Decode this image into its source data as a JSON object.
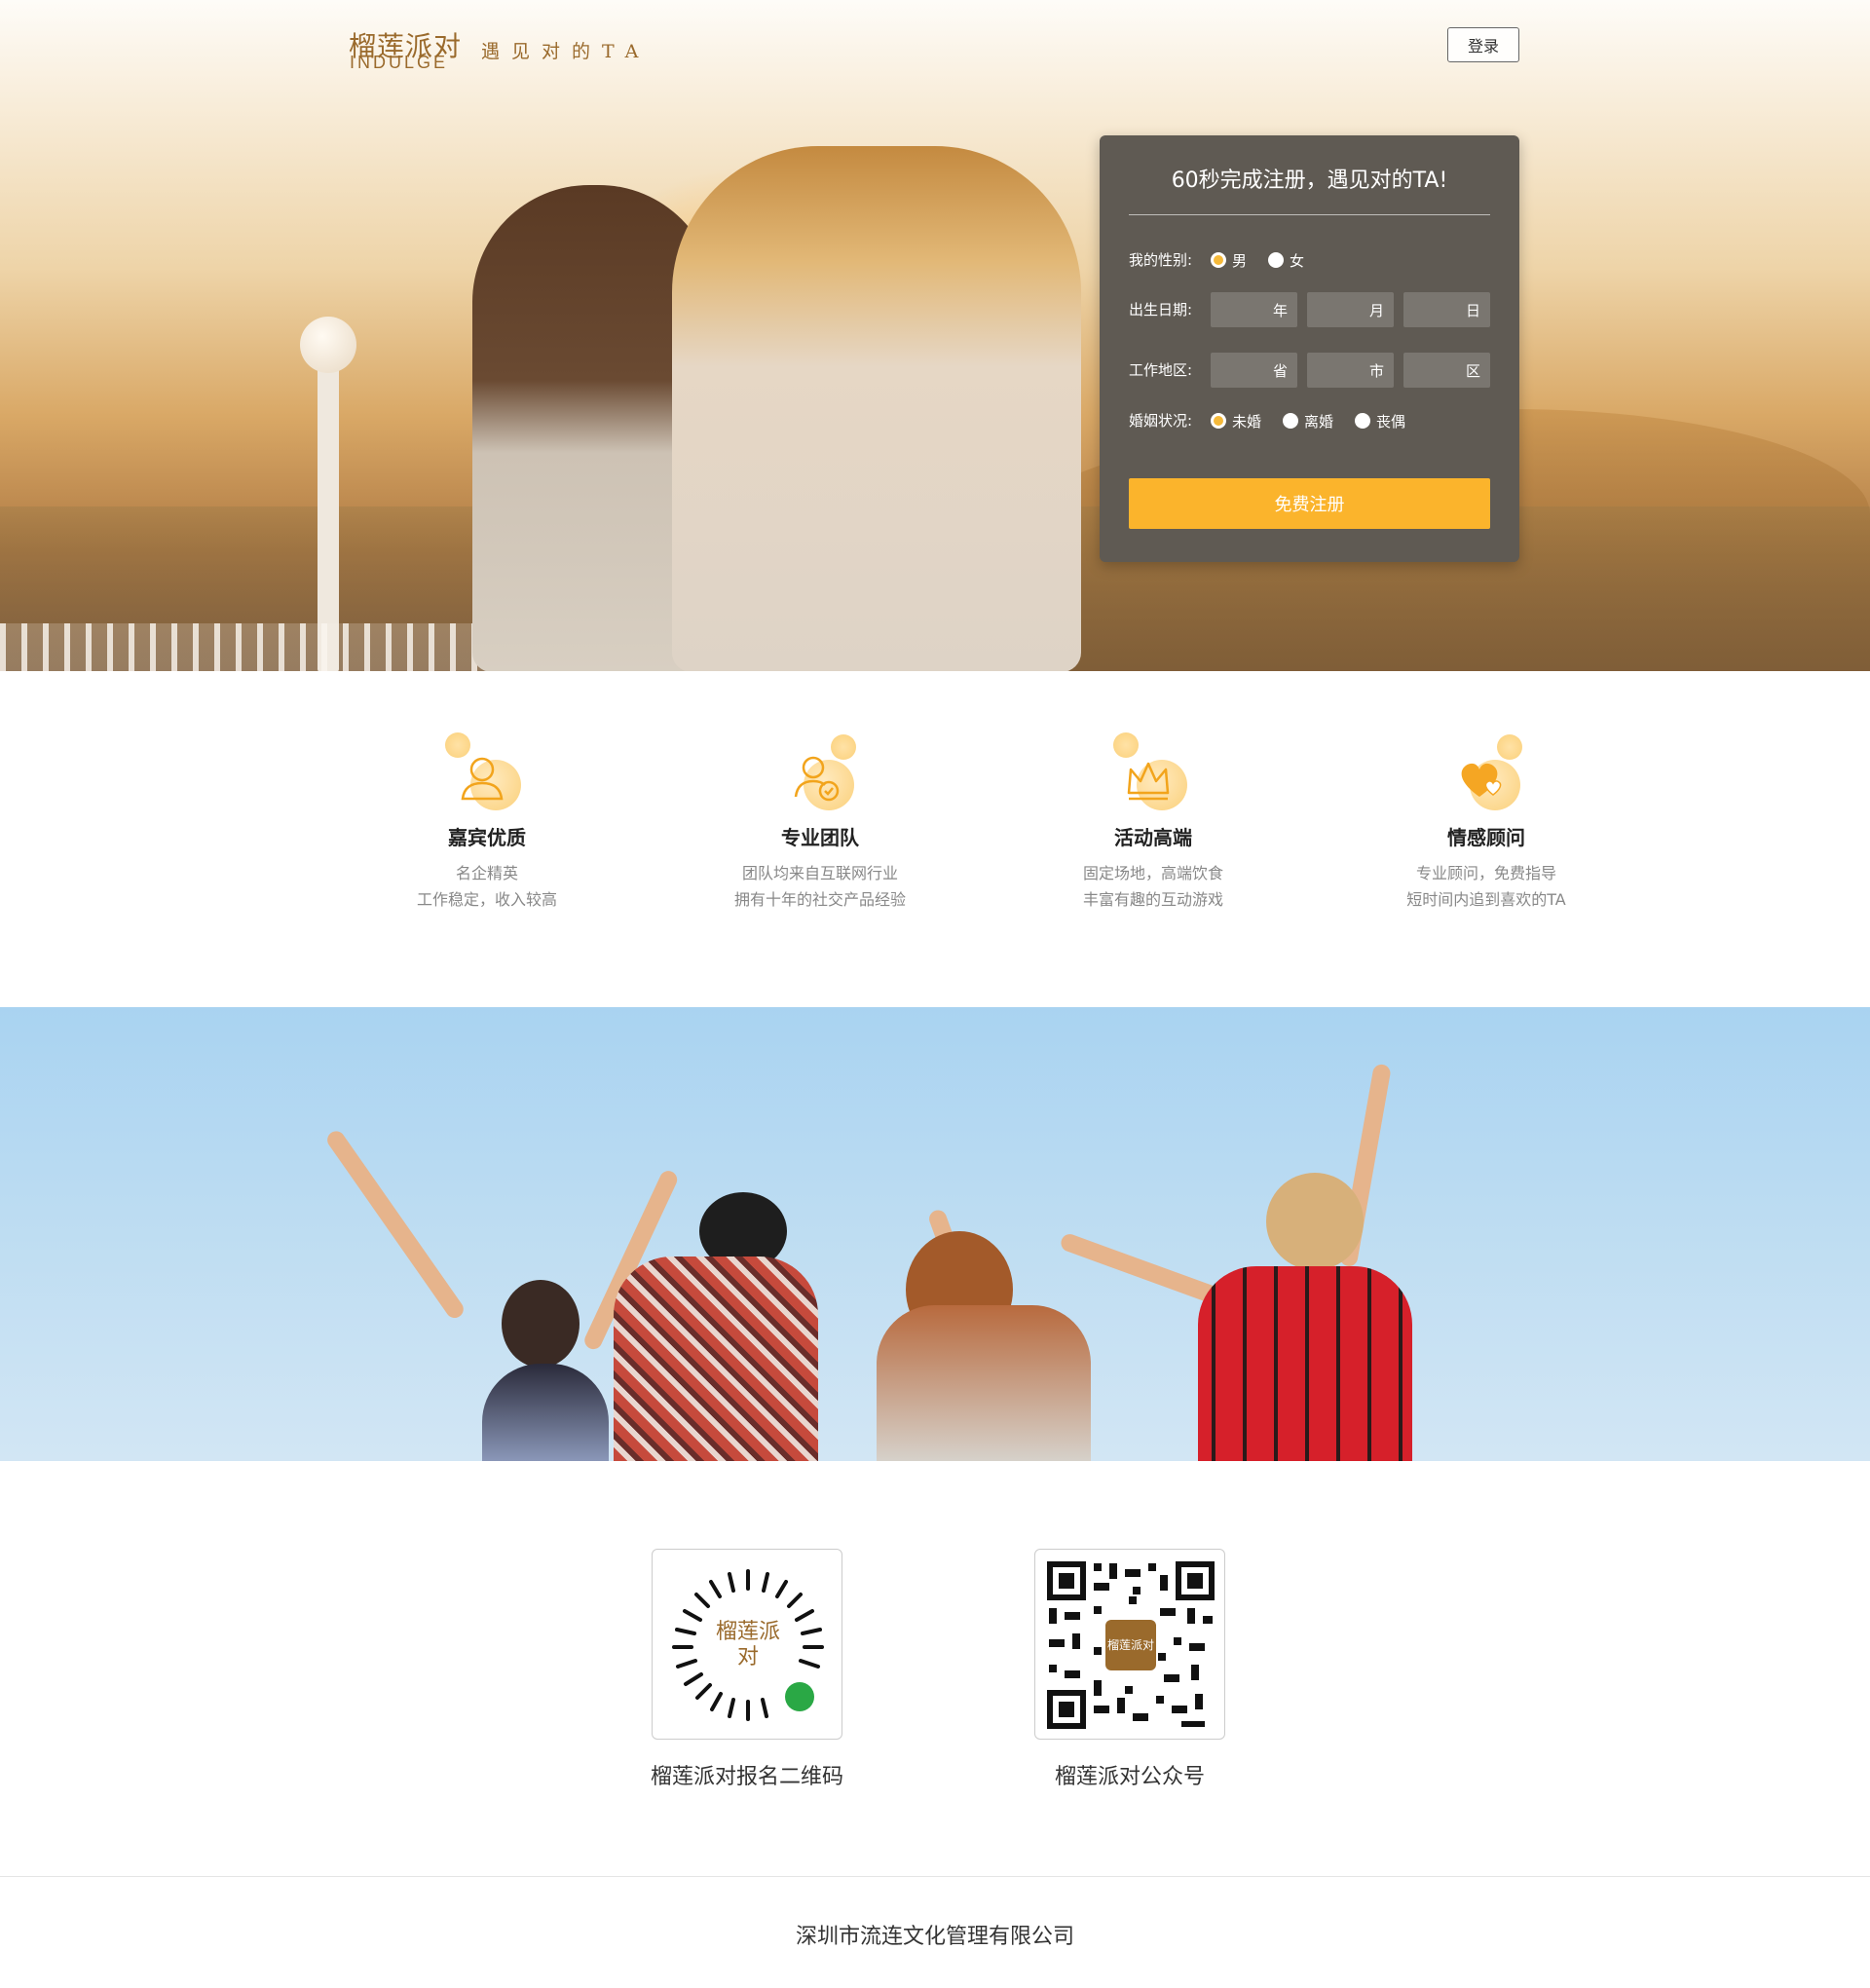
{
  "header": {
    "logo_cn": "榴莲派对",
    "logo_en": "INDULGE",
    "slogan": "遇见对的TA",
    "login_label": "登录"
  },
  "register": {
    "title": "60秒完成注册，遇见对的TA!",
    "gender": {
      "label": "我的性别:",
      "options": [
        "男",
        "女"
      ],
      "selected": "男"
    },
    "birthday": {
      "label": "出生日期:",
      "fields": [
        "年",
        "月",
        "日"
      ]
    },
    "region": {
      "label": "工作地区:",
      "fields": [
        "省",
        "市",
        "区"
      ]
    },
    "marital": {
      "label": "婚姻状况:",
      "options": [
        "未婚",
        "离婚",
        "丧偶"
      ],
      "selected": "未婚"
    },
    "submit_label": "免费注册"
  },
  "features": [
    {
      "title": "嘉宾优质",
      "line1": "名企精英",
      "line2": "工作稳定，收入较高",
      "icon": "person-icon"
    },
    {
      "title": "专业团队",
      "line1": "团队均来自互联网行业",
      "line2": "拥有十年的社交产品经验",
      "icon": "verified-person-icon"
    },
    {
      "title": "活动高端",
      "line1": "固定场地，高端饮食",
      "line2": "丰富有趣的互动游戏",
      "icon": "crown-icon"
    },
    {
      "title": "情感顾问",
      "line1": "专业顾问，免费指导",
      "line2": "短时间内追到喜欢的TA",
      "icon": "heart-icon"
    }
  ],
  "qr": [
    {
      "label": "榴莲派对报名二维码",
      "center": "榴莲派对"
    },
    {
      "label": "榴莲派对公众号",
      "center": "榴莲派对"
    }
  ],
  "footer": {
    "company": "深圳市流连文化管理有限公司"
  },
  "colors": {
    "accent": "#fbb42c",
    "brand": "#9a6a2c",
    "panel": "#5f5a53"
  }
}
